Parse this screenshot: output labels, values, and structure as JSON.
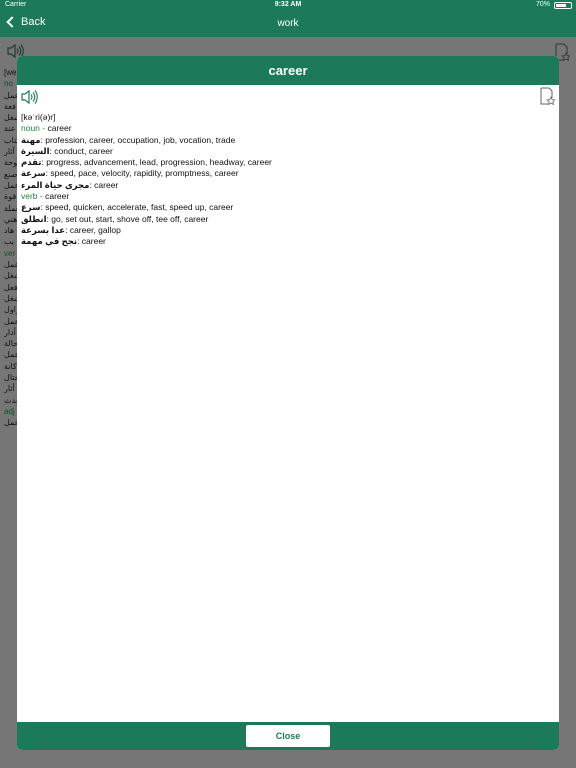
{
  "status_bar": {
    "carrier": "Carrier",
    "time": "9:32 AM",
    "battery": "70%"
  },
  "nav": {
    "back_label": "Back",
    "title": "work"
  },
  "background": {
    "pronunciation_prefix": "[we",
    "lines": [
      {
        "t": "no",
        "green": true
      },
      {
        "t": "عمل",
        "green": false
      },
      {
        "t": "فعة",
        "green": false
      },
      {
        "t": "شغل",
        "green": false
      },
      {
        "t": "عنة",
        "green": false
      },
      {
        "t": "كتاب",
        "green": false
      },
      {
        "t": "آثار",
        "green": false
      },
      {
        "t": "لوحة",
        "green": false
      },
      {
        "t": "صنع",
        "green": false
      },
      {
        "t": "عمل",
        "green": false
      },
      {
        "t": "قوة",
        "green": false
      },
      {
        "t": "عملة",
        "green": false
      },
      {
        "t": "هني",
        "green": false
      },
      {
        "t": "هاد",
        "green": false
      },
      {
        "t": "يب",
        "green": false
      },
      {
        "t": "ver",
        "green": true
      },
      {
        "t": "عمل",
        "green": false
      },
      {
        "t": "شغل",
        "green": false
      },
      {
        "t": "فعل",
        "green": false
      },
      {
        "t": "شغل",
        "green": false
      },
      {
        "t": "زاول",
        "green": false
      },
      {
        "t": "عمل",
        "green": false
      },
      {
        "t": "أدار",
        "green": false
      },
      {
        "t": "حالة",
        "green": false
      },
      {
        "t": "عمل",
        "green": false
      },
      {
        "t": "كانة",
        "green": false
      },
      {
        "t": "حتال",
        "green": false
      },
      {
        "t": "أثار",
        "green": false
      },
      {
        "t": "حدث",
        "green": false
      },
      {
        "t": "adj",
        "green": true
      },
      {
        "t": "عمل",
        "green": false
      }
    ]
  },
  "modal": {
    "title": "career",
    "icons": {
      "speaker": "speaker-icon",
      "bookmark": "bookmark-star-icon"
    },
    "pronunciation": "[kəˈri(ə)r]",
    "sections": [
      {
        "pos": "noun",
        "word": "career",
        "senses": [
          {
            "ar": "مهنة",
            "en": "profession, career, occupation, job, vocation, trade"
          },
          {
            "ar": "السيرة",
            "en": "conduct, career"
          },
          {
            "ar": "تقدم",
            "en": "progress, advancement, lead, progression, headway, career"
          },
          {
            "ar": "سرعة",
            "en": "speed, pace, velocity, rapidity, promptness, career"
          },
          {
            "ar": "مجرى حياة المرء",
            "en": "career"
          }
        ]
      },
      {
        "pos": "verb",
        "word": "career",
        "senses": [
          {
            "ar": "سرع",
            "en": "speed, quicken, accelerate, fast, speed up, career"
          },
          {
            "ar": "انطلق",
            "en": "go, set out, start, shove off, tee off, career"
          },
          {
            "ar": "عدا بسرعة",
            "en": "career, gallop"
          },
          {
            "ar": "نجح في مهمة",
            "en": "career"
          }
        ]
      }
    ],
    "close_label": "Close"
  }
}
